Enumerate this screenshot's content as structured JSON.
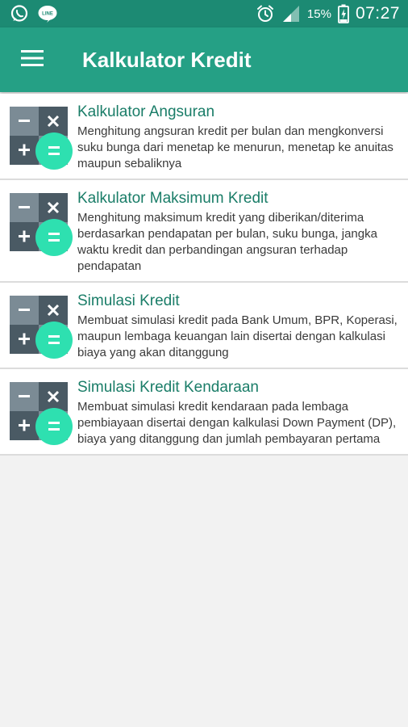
{
  "status_bar": {
    "icons_left": [
      "whatsapp-icon",
      "line-icon"
    ],
    "alarm_icon": "alarm-icon",
    "signal_icon": "signal-icon",
    "battery_percent": "15%",
    "time": "07:27"
  },
  "app_bar": {
    "menu_icon": "menu-icon",
    "title": "Kalkulator Kredit"
  },
  "list": [
    {
      "title": "Kalkulator Angsuran",
      "description": "Menghitung angsuran kredit per bulan dan mengkonversi suku bunga dari menetap ke menurun, menetap ke anuitas maupun sebaliknya"
    },
    {
      "title": "Kalkulator Maksimum Kredit",
      "description": "Menghitung maksimum kredit yang diberikan/diterima berdasarkan pendapatan per bulan, suku bunga, jangka waktu kredit dan perbandingan angsuran terhadap pendapatan"
    },
    {
      "title": "Simulasi Kredit",
      "description": "Membuat simulasi kredit pada Bank Umum, BPR, Koperasi, maupun lembaga keuangan lain disertai dengan kalkulasi biaya yang akan ditanggung"
    },
    {
      "title": "Simulasi Kredit Kendaraan",
      "description": "Membuat simulasi kredit kendaraan pada lembaga pembiayaan disertai dengan kalkulasi Down Payment (DP), biaya yang ditanggung dan jumlah pembayaran pertama"
    }
  ],
  "colors": {
    "status_bar": "#1c8a73",
    "app_bar": "#25a085",
    "title_text": "#1a7d68",
    "icon_dark": "#4a5a64",
    "icon_light": "#7b8b95",
    "icon_accent": "#2ee0b0"
  }
}
